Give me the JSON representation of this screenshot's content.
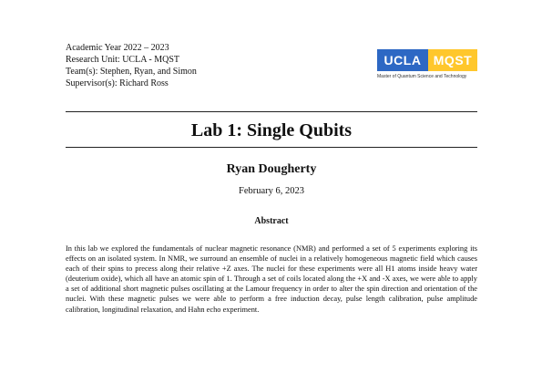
{
  "header": {
    "academic_year": "Academic Year 2022  – 2023",
    "research_unit": "Research Unit:  UCLA - MQST",
    "teams": "Team(s):  Stephen, Ryan, and Simon",
    "supervisor": "Supervisor(s):  Richard Ross"
  },
  "logo": {
    "left_text": "UCLA",
    "right_text": "MQST",
    "caption": "Master of Quantum Science and Technology",
    "colors": {
      "blue": "#2d68c4",
      "gold": "#ffc72c"
    }
  },
  "paper": {
    "title": "Lab 1:  Single Qubits",
    "author": "Ryan Dougherty",
    "date": "February 6, 2023",
    "abstract_heading": "Abstract",
    "abstract_text": "In this lab we explored the fundamentals of nuclear magnetic resonance (NMR) and performed a set of 5 experiments exploring its effects on an isolated system.  In NMR, we surround an ensemble of nuclei in a relatively homogeneous magnetic field which causes each of their spins to precess along their relative +Z axes.  The nuclei for these experiments were all H1 atoms inside heavy water (deuterium oxide), which all have an atomic spin of 1.  Through a set of coils located along the +X and -X axes, we were able to apply a set of additional short magnetic pulses oscillating at the Lamour frequency in order to alter the spin direction and orientation of the nuclei.  With these magnetic pulses we were able to perform a free induction decay, pulse length calibration, pulse amplitude calibration, longitudinal relaxation, and Hahn echo experiment."
  }
}
